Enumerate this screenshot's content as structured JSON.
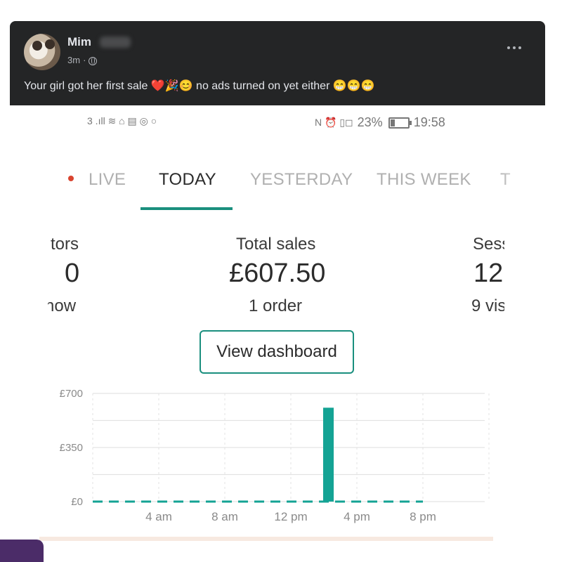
{
  "post": {
    "author": "Mim",
    "time": "3m",
    "separator": "·",
    "privacy_icon": "globe-icon",
    "text": "Your girl got her first sale ❤️🎉😊 no ads turned on yet either 😁😁😁"
  },
  "phone": {
    "status_left": [
      "3",
      "▁▃▅",
      "wifi",
      "bag",
      "news",
      "cast",
      "circle"
    ],
    "status_left_text": "3 .ıll ≋ ⌂ ▤ ◎ ○",
    "status_right_text": "N ⏰ ▯◻",
    "battery": "23%",
    "time": "19:58",
    "tabs": [
      {
        "label": "LIVE",
        "active": false
      },
      {
        "label": "TODAY",
        "active": true
      },
      {
        "label": "YESTERDAY",
        "active": false
      },
      {
        "label": "THIS WEEK",
        "active": false
      },
      {
        "label": "T",
        "active": false
      }
    ],
    "stats": {
      "left": {
        "label": "tors",
        "value": "0",
        "sub": "now"
      },
      "center": {
        "label": "Total sales",
        "value": "£607.50",
        "sub": "1 order"
      },
      "right": {
        "label": "Sess",
        "value": "12",
        "sub": "9 vis"
      }
    },
    "dashboard_button": "View dashboard"
  },
  "chart_data": {
    "type": "bar",
    "y_ticks": [
      "£700",
      "£350",
      "£0"
    ],
    "ylim": [
      0,
      700
    ],
    "x_ticks": [
      "4 am",
      "8 am",
      "12 pm",
      "4 pm",
      "8 pm"
    ],
    "x_tick_hours": [
      4,
      8,
      12,
      16,
      20
    ],
    "bar": {
      "hour": 14,
      "value": 607.5
    },
    "baseline_hours": [
      0,
      20
    ],
    "colors": {
      "bar": "#14a394",
      "grid": "#e3e3e3",
      "axis_text": "#8a8a8a"
    }
  },
  "colors": {
    "card_bg": "#242526",
    "accent": "#1a8f7e",
    "live_dot": "#d9442f"
  }
}
